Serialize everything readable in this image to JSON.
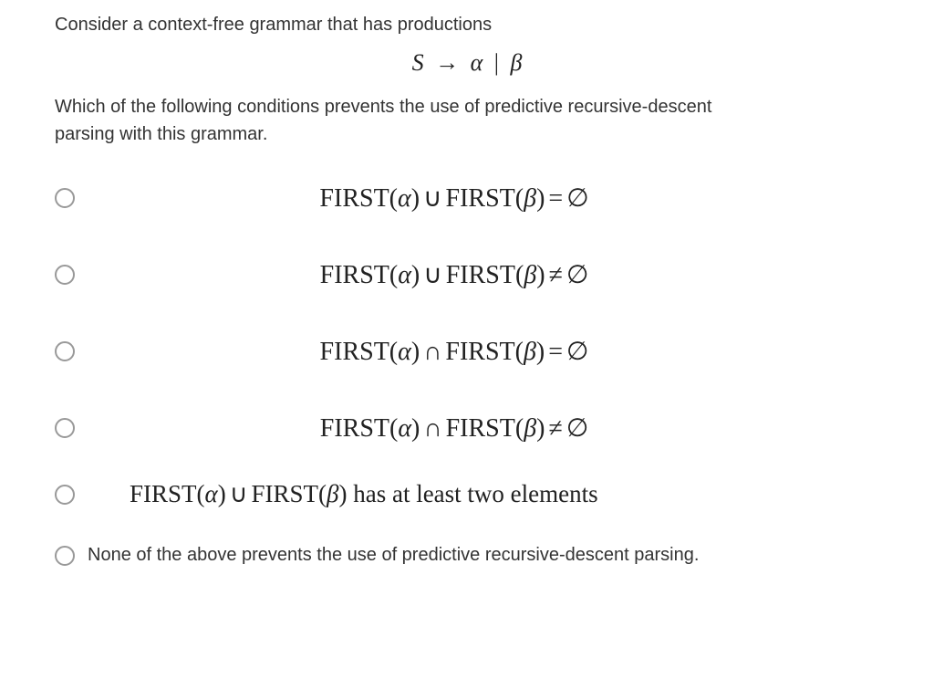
{
  "question": {
    "intro": "Consider a context-free grammar that has productions",
    "production": {
      "lhs": "S",
      "arrow": "→",
      "rhs1": "α",
      "pipe": "|",
      "rhs2": "β"
    },
    "tail_line1": " Which of the following conditions prevents the use of predictive recursive-descent",
    "tail_line2": "parsing with this grammar."
  },
  "options": {
    "a": {
      "first_alpha": "FIRST",
      "alpha": "α",
      "op": "∪",
      "first_beta": "FIRST",
      "beta": "β",
      "rel": "=",
      "empty": "∅"
    },
    "b": {
      "first_alpha": "FIRST",
      "alpha": "α",
      "op": "∪",
      "first_beta": "FIRST",
      "beta": "β",
      "rel": "≠",
      "empty": "∅"
    },
    "c": {
      "first_alpha": "FIRST",
      "alpha": "α",
      "op": "∩",
      "first_beta": "FIRST",
      "beta": "β",
      "rel": "=",
      "empty": "∅"
    },
    "d": {
      "first_alpha": "FIRST",
      "alpha": "α",
      "op": "∩",
      "first_beta": "FIRST",
      "beta": "β",
      "rel": "≠",
      "empty": "∅"
    },
    "e": {
      "first_alpha": "FIRST",
      "alpha": "α",
      "op": "∪",
      "first_beta": "FIRST",
      "beta": "β",
      "tail": " has at least two elements"
    },
    "f": {
      "text": "None of the above prevents the use of predictive recursive-descent parsing."
    }
  }
}
